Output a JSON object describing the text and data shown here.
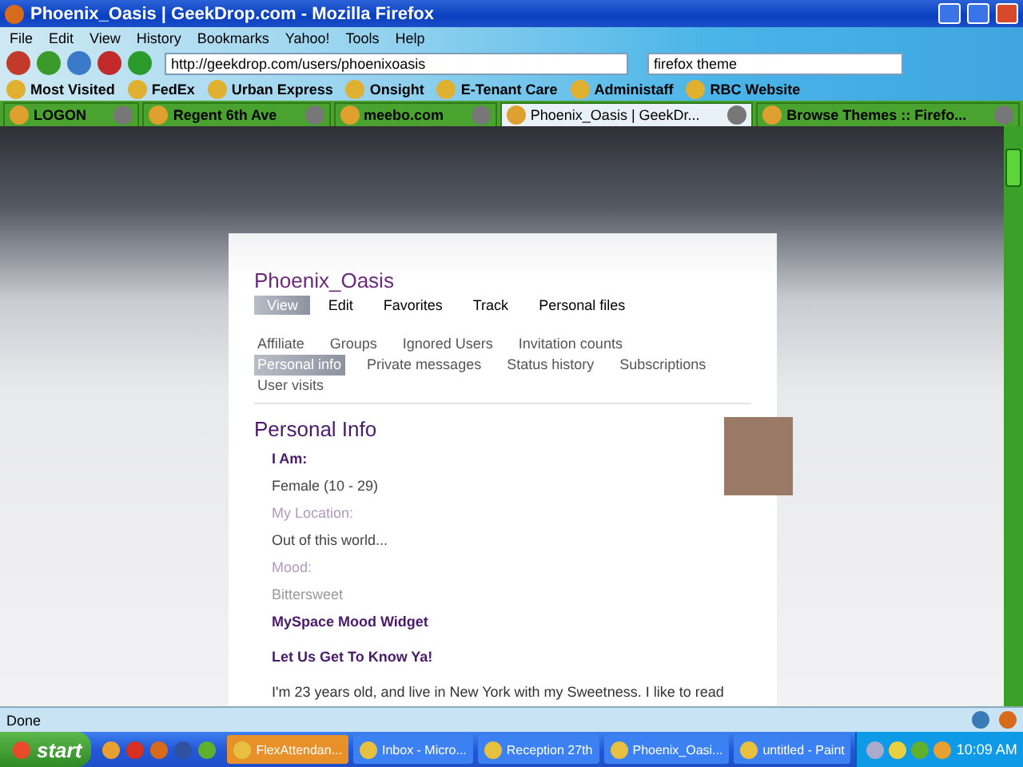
{
  "window": {
    "title": "Phoenix_Oasis | GeekDrop.com - Mozilla Firefox"
  },
  "menu": [
    "File",
    "Edit",
    "View",
    "History",
    "Bookmarks",
    "Yahoo!",
    "Tools",
    "Help"
  ],
  "address_bar": {
    "value": "http://geekdrop.com/users/phoenixoasis"
  },
  "search_field": {
    "value": "firefox theme"
  },
  "bookmarks": [
    "Most Visited",
    "FedEx",
    "Urban Express",
    "Onsight",
    "E-Tenant Care",
    "Administaff",
    "RBC Website"
  ],
  "tabs": [
    {
      "label": "LOGON",
      "selected": false
    },
    {
      "label": "Regent 6th Ave",
      "selected": false
    },
    {
      "label": "meebo.com",
      "selected": false
    },
    {
      "label": "Phoenix_Oasis | GeekDr...",
      "selected": true
    },
    {
      "label": "Browse Themes :: Firefo...",
      "selected": false
    }
  ],
  "page": {
    "username": "Phoenix_Oasis",
    "primary_tabs": [
      {
        "label": "View",
        "selected": true
      },
      {
        "label": "Edit",
        "selected": false
      },
      {
        "label": "Favorites",
        "selected": false
      },
      {
        "label": "Track",
        "selected": false
      },
      {
        "label": "Personal files",
        "selected": false
      }
    ],
    "secondary_tabs": [
      {
        "label": "Affiliate",
        "selected": false
      },
      {
        "label": "Groups",
        "selected": false
      },
      {
        "label": "Ignored Users",
        "selected": false
      },
      {
        "label": "Invitation counts",
        "selected": false
      },
      {
        "label": "Personal info",
        "selected": true
      },
      {
        "label": "Private messages",
        "selected": false
      },
      {
        "label": "Status history",
        "selected": false
      },
      {
        "label": "Subscriptions",
        "selected": false
      },
      {
        "label": "User visits",
        "selected": false
      }
    ],
    "section_title": "Personal Info",
    "items": [
      {
        "kind": "label",
        "text": "I Am:"
      },
      {
        "kind": "value",
        "text": "Female (10 - 29)"
      },
      {
        "kind": "faint-label",
        "text": "My Location:"
      },
      {
        "kind": "value",
        "text": "Out of this world..."
      },
      {
        "kind": "faint-label",
        "text": "Mood:"
      },
      {
        "kind": "faint-value",
        "text": "Bittersweet"
      },
      {
        "kind": "heading",
        "text": "MySpace Mood Widget"
      },
      {
        "kind": "heading",
        "text": "Let Us Get To Know Ya!"
      },
      {
        "kind": "paragraph",
        "text": "I'm 23 years old, and live in New York with my Sweetness. I like to read"
      }
    ]
  },
  "status_bar": {
    "text": "Done"
  },
  "taskbar": {
    "start": "start",
    "tasks": [
      {
        "label": "FlexAttendan...",
        "selected": true
      },
      {
        "label": "Inbox - Micro...",
        "selected": false
      },
      {
        "label": "Reception 27th",
        "selected": false
      },
      {
        "label": "Phoenix_Oasi...",
        "selected": false
      },
      {
        "label": "untitled - Paint",
        "selected": false
      }
    ],
    "clock": "10:09 AM"
  }
}
